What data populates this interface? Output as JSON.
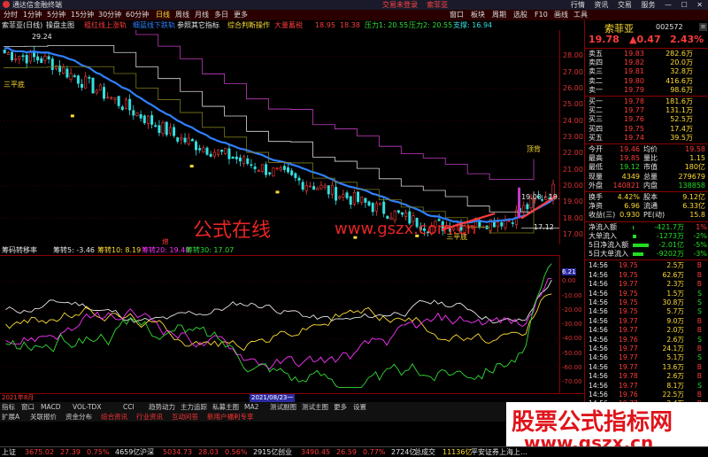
{
  "window": {
    "app_title": "通达信金融终端",
    "center_links": [
      "交易未登录",
      "索菲亚"
    ],
    "right_links": [
      "行情",
      "资讯",
      "交易",
      "服务"
    ]
  },
  "menu": {
    "items": [
      "分时",
      "1分钟",
      "5分钟",
      "15分钟",
      "30分钟",
      "60分钟",
      "日线",
      "周线",
      "月线",
      "多日",
      "更多"
    ],
    "right_items": [
      "窗口",
      "板块",
      "周期",
      "选股",
      "F10",
      "画线",
      "工具"
    ]
  },
  "toolbar": {
    "stock": "索菲亚(日线)",
    "main_indicator": "操盘主图",
    "signals": [
      "粗红线上涨轨",
      "细蓝线下跌轨",
      "参照其它指标",
      "综合判断操作",
      "大量蓄税"
    ],
    "values": [
      "18.95",
      "18.38"
    ],
    "pressure": "压力1: 20.55",
    "pressure2": "压力2: 20.55",
    "support": "支撑: 16.94"
  },
  "main_axis": [
    "29.24",
    "28.00",
    "27.00",
    "26.00",
    "25.00",
    "24.00",
    "23.00",
    "22.00",
    "21.00",
    "20.00",
    "19.00",
    "18.00",
    "17.00"
  ],
  "chart_labels": {
    "high_price": "29.24",
    "low_price": "17.12",
    "range_label": "19.00 - 19.12",
    "signal_left": "三平底",
    "signal_right": "顶背",
    "signal_mid": "三平底",
    "add_mark": "增"
  },
  "indicator": {
    "name": "筹码转移率",
    "items": [
      {
        "label": "筹转5",
        "value": "-3.46",
        "color": "#e6e6e6"
      },
      {
        "label": "筹转10",
        "value": "8.19",
        "color": "#ffdd33"
      },
      {
        "label": "筹转20",
        "value": "19.48",
        "color": "#ff33ff"
      },
      {
        "label": "筹转30",
        "value": "17.07",
        "color": "#33dd33"
      }
    ],
    "axis": [
      "6.21",
      "0.00",
      "-10.00",
      "-20.00",
      "-30.00",
      "-40.00",
      "-50.00",
      "-60.00",
      "-70.00"
    ]
  },
  "date_bar": {
    "left": "2021年8月",
    "cursor": "2021/08/23一"
  },
  "bottom_tabs_1": [
    "指标",
    "窗口",
    "MACD",
    "VOL-TDX",
    "CCI",
    "趋势动力",
    "主力追踪",
    "私募主图",
    "MA2",
    "测试副图",
    "测试主图",
    "更多",
    "设置"
  ],
  "bottom_tabs_2": [
    "扩展A",
    "关联报价",
    "资金分布",
    "综合资讯",
    "行业资讯",
    "互动问答",
    "新用户福利专享"
  ],
  "status": {
    "items": [
      {
        "name": "上证",
        "value": "3675.02",
        "chg": "27.39",
        "pct": "0.75%",
        "vol": "4659亿",
        "dir": "up"
      },
      {
        "name": "沪深",
        "value": "5034.73",
        "chg": "28.03",
        "pct": "0.56%",
        "vol": "2915亿",
        "dir": "up"
      },
      {
        "name": "创业",
        "value": "3490.45",
        "chg": "26.59",
        "pct": "0.77%",
        "vol": "2724亿",
        "dir": "up"
      }
    ],
    "total": "总成交",
    "total_value": "11136亿",
    "ticker": "平安证券上海上…"
  },
  "panel": {
    "stock_name": "索菲亚",
    "stock_code": "002572",
    "last": "19.78",
    "change": "▲0.47",
    "pct": "2.43%",
    "asks": [
      {
        "label": "卖五",
        "price": "19.83",
        "vol": "282.6万"
      },
      {
        "label": "卖四",
        "price": "19.82",
        "vol": "20.0万"
      },
      {
        "label": "卖三",
        "price": "19.81",
        "vol": "32.8万"
      },
      {
        "label": "卖二",
        "price": "19.80",
        "vol": "416.6万"
      },
      {
        "label": "卖一",
        "price": "19.79",
        "vol": "98.6万"
      }
    ],
    "bids": [
      {
        "label": "买一",
        "price": "19.78",
        "vol": "181.6万"
      },
      {
        "label": "买二",
        "price": "19.77",
        "vol": "131.1万"
      },
      {
        "label": "买三",
        "price": "19.76",
        "vol": "52.5万"
      },
      {
        "label": "买四",
        "price": "19.75",
        "vol": "17.4万"
      },
      {
        "label": "买五",
        "price": "19.74",
        "vol": "39.5万"
      }
    ],
    "stats": [
      {
        "l1": "今开",
        "v1": "19.46",
        "l2": "均价",
        "v2": "19.58"
      },
      {
        "l1": "最高",
        "v1": "19.85",
        "l2": "量比",
        "v2": "1.15"
      },
      {
        "l1": "最低",
        "v1": "19.12",
        "l2": "市值",
        "v2": "180亿"
      },
      {
        "l1": "现量",
        "v1": "4349",
        "l2": "总量",
        "v2": "279679"
      },
      {
        "l1": "外盘",
        "v1": "140821",
        "l2": "内盘",
        "v2": "138858"
      }
    ],
    "stats2": [
      {
        "l1": "换手",
        "v1": "4.42%",
        "l2": "股本",
        "v2": "9.12亿"
      },
      {
        "l1": "净资",
        "v1": "6.96",
        "l2": "流通",
        "v2": "6.33亿"
      },
      {
        "l1": "收益(三)",
        "v1": "0.930",
        "l2": "PE(动)",
        "v2": "15.8"
      }
    ],
    "flows": [
      {
        "label": "净流入额",
        "value": "-421.7万",
        "pct": "1%",
        "bar": 0.02
      },
      {
        "label": "大单流入",
        "value": "-1273万",
        "pct": "-2%",
        "bar": 0.1
      },
      {
        "label": "5日净流入额",
        "value": "-2.01亿",
        "pct": "-5%",
        "bar": 0.45
      },
      {
        "label": "5日大单流入",
        "value": "-9202万",
        "pct": "-3%",
        "bar": 0.3
      }
    ],
    "ticks": [
      {
        "t": "14:56",
        "p": "19.75",
        "v": "2.5万",
        "f": "B"
      },
      {
        "t": "14:56",
        "p": "19.75",
        "v": "62.6万",
        "f": "B"
      },
      {
        "t": "14:56",
        "p": "19.77",
        "v": "2.3万",
        "f": "B"
      },
      {
        "t": "14:56",
        "p": "19.75",
        "v": "1.5万",
        "f": "S"
      },
      {
        "t": "14:56",
        "p": "19.75",
        "v": "30.8万",
        "f": "S"
      },
      {
        "t": "14:56",
        "p": "19.75",
        "v": "5.7万",
        "f": "S"
      },
      {
        "t": "14:56",
        "p": "19.77",
        "v": "9.0万",
        "f": "B"
      },
      {
        "t": "14:56",
        "p": "19.77",
        "v": "2.0万",
        "f": "B"
      },
      {
        "t": "14:56",
        "p": "19.76",
        "v": "2.6万",
        "f": "S"
      },
      {
        "t": "14:56",
        "p": "19.77",
        "v": "24.1万",
        "f": "B"
      },
      {
        "t": "14:56",
        "p": "19.77",
        "v": "5.1万",
        "f": "S"
      },
      {
        "t": "14:56",
        "p": "19.77",
        "v": "13.6万",
        "f": "B"
      },
      {
        "t": "14:56",
        "p": "19.78",
        "v": "2.6万",
        "f": "B"
      },
      {
        "t": "14:56",
        "p": "19.77",
        "v": "8.1万",
        "f": "S"
      },
      {
        "t": "14:56",
        "p": "19.76",
        "v": "22.5万",
        "f": "B"
      },
      {
        "t": "14:56",
        "p": "19.77",
        "v": "2.4万",
        "f": "B"
      },
      {
        "t": "14:56",
        "p": "19.76",
        "v": "3.0万",
        "f": "S"
      }
    ]
  },
  "watermarks": {
    "center1": "公式在线",
    "center2": "www.gszx.com.cn",
    "brand_line1": "股票公式指标网",
    "brand_line2": "www.gszx.cn"
  },
  "colors": {
    "up": "#ff3b3b",
    "down": "#22dd22",
    "candle_down": "#33e0e0",
    "ma_blue": "#2f80ff",
    "stair_line": "#d9d9d9",
    "olive_line": "#7a7a1a",
    "purple_line": "#c23cc2"
  }
}
